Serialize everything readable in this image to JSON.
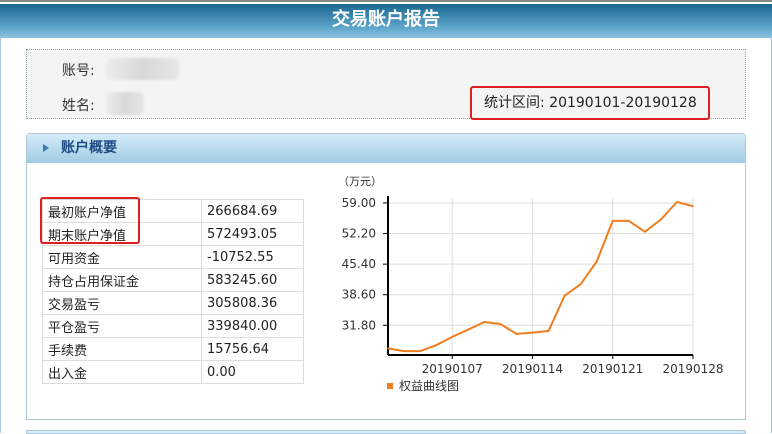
{
  "title": "交易账户报告",
  "info": {
    "account_label": "账号:",
    "name_label": "姓名:",
    "period_label": "统计区间:",
    "period_value": "20190101-20190128"
  },
  "summary": {
    "heading": "账户概要",
    "rows": [
      {
        "k": "最初账户净值",
        "v": "266684.69"
      },
      {
        "k": "期末账户净值",
        "v": "572493.05"
      },
      {
        "k": "可用资金",
        "v": "-10752.55"
      },
      {
        "k": "持仓占用保证金",
        "v": "583245.60"
      },
      {
        "k": "交易盈亏",
        "v": "305808.36"
      },
      {
        "k": "平仓盈亏",
        "v": "339840.00"
      },
      {
        "k": "手续费",
        "v": "15756.64"
      },
      {
        "k": "出入金",
        "v": "0.00"
      }
    ]
  },
  "chart_data": {
    "type": "line",
    "unit_label": "（万元）",
    "legend": "权益曲线图",
    "legend_position": "bottom-left",
    "color": "#f07d1e",
    "ylim": [
      25.2,
      60.1
    ],
    "y_ticks": [
      "31.80",
      "38.60",
      "45.40",
      "52.20",
      "59.00"
    ],
    "x_ticks": [
      {
        "index": 4,
        "label": "20190107"
      },
      {
        "index": 9,
        "label": "20190114"
      },
      {
        "index": 14,
        "label": "20190121"
      },
      {
        "index": 19,
        "label": "20190128"
      }
    ],
    "values": [
      26.67,
      26.06,
      26.06,
      27.38,
      29.23,
      30.85,
      32.54,
      32.1,
      29.89,
      30.18,
      30.55,
      38.36,
      40.94,
      45.96,
      55.02,
      55.02,
      52.59,
      55.31,
      59.22,
      58.26
    ],
    "grid": true
  }
}
